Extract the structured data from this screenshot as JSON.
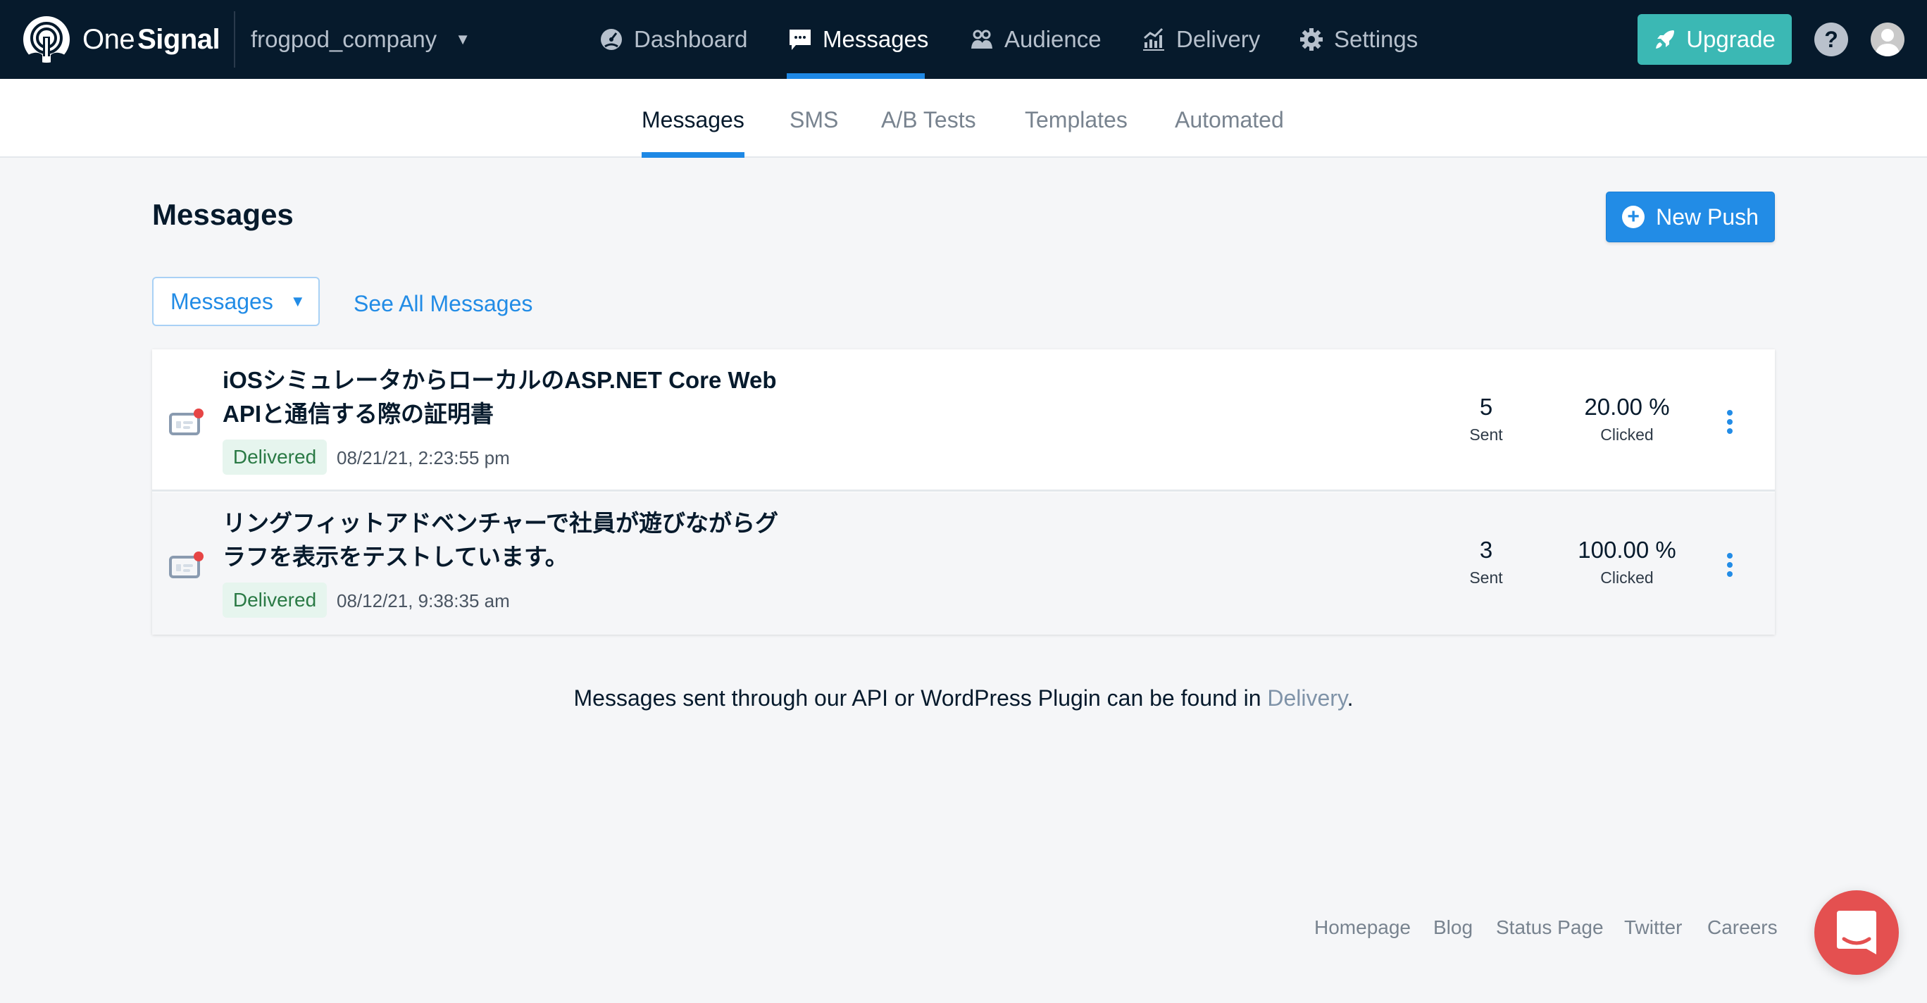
{
  "app": {
    "brand_part1": "One",
    "brand_part2": "Signal",
    "org_name": "frogpod_company"
  },
  "topnav": {
    "items": [
      {
        "label": "Dashboard",
        "icon": "dashboard-gauge-icon"
      },
      {
        "label": "Messages",
        "icon": "chat-bubble-icon",
        "active": true
      },
      {
        "label": "Audience",
        "icon": "users-icon"
      },
      {
        "label": "Delivery",
        "icon": "chart-icon"
      },
      {
        "label": "Settings",
        "icon": "gear-icon"
      }
    ],
    "upgrade_label": "Upgrade",
    "help_label": "?"
  },
  "subnav": {
    "tabs": [
      {
        "label": "Messages",
        "active": true
      },
      {
        "label": "SMS"
      },
      {
        "label": "A/B Tests"
      },
      {
        "label": "Templates"
      },
      {
        "label": "Automated"
      }
    ]
  },
  "page": {
    "title": "Messages",
    "new_push_label": "New Push",
    "filter_selected": "Messages",
    "see_all_label": "See All Messages"
  },
  "messages": [
    {
      "title": "iOSシミュレータからローカルのASP.NET Core Web APIと通信する際の証明書",
      "status": "Delivered",
      "date": "08/21/21, 2:23:55 pm",
      "sent": "5",
      "sent_label": "Sent",
      "clicked": "20.00 %",
      "clicked_label": "Clicked"
    },
    {
      "title": "リングフィットアドベンチャーで社員が遊びながらグラフを表示をテストしています。",
      "status": "Delivered",
      "date": "08/12/21, 9:38:35 am",
      "sent": "3",
      "sent_label": "Sent",
      "clicked": "100.00 %",
      "clicked_label": "Clicked"
    }
  ],
  "note": {
    "text": "Messages sent through our API or WordPress Plugin can be found in ",
    "link": "Delivery",
    "suffix": "."
  },
  "footer": {
    "links": [
      "Homepage",
      "Blog",
      "Status Page",
      "Twitter",
      "Careers"
    ]
  },
  "colors": {
    "nav_bg": "#061a2c",
    "accent": "#228ce6",
    "upgrade": "#3bb8b4",
    "delivered_bg": "#e6f5ee",
    "delivered_text": "#2a7a45",
    "chat": "#e45050"
  }
}
